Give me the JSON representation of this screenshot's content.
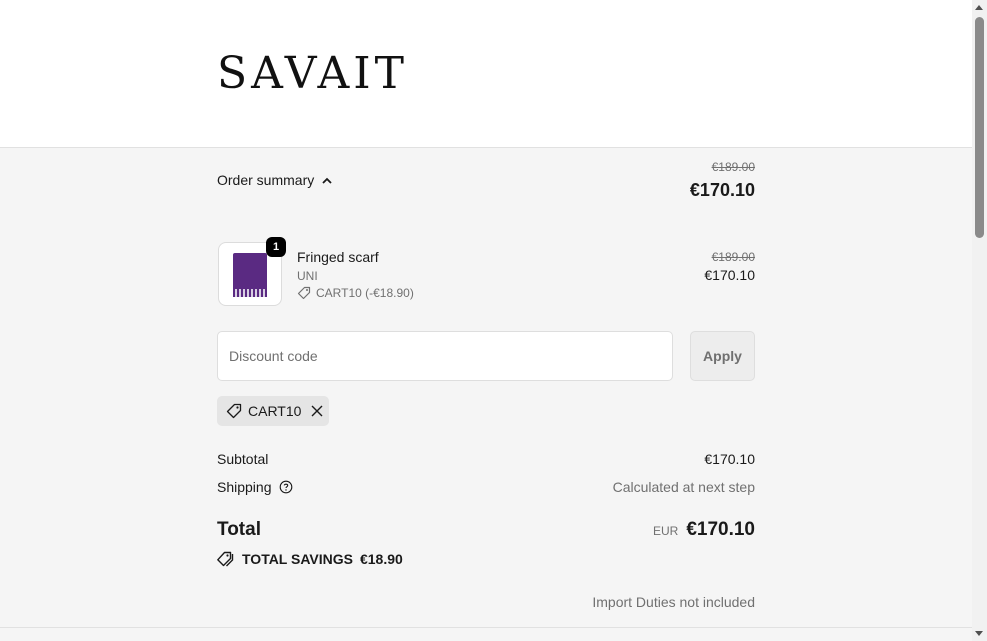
{
  "brand": {
    "logo_text": "SAVAIT"
  },
  "order_summary": {
    "toggle_label": "Order summary",
    "original_price": "€189.00",
    "total_price": "€170.10",
    "chevron_icon": "chevron-up-icon"
  },
  "line_item": {
    "quantity": "1",
    "name": "Fringed scarf",
    "variant": "UNI",
    "discount_label": "CART10 (-€18.90)",
    "original_price": "€189.00",
    "price": "€170.10",
    "thumbnail_color": "#5a2a82"
  },
  "discount": {
    "placeholder": "Discount code",
    "value": "",
    "apply_label": "Apply",
    "applied_code": "CART10"
  },
  "totals": {
    "subtotal_label": "Subtotal",
    "subtotal_value": "€170.10",
    "shipping_label": "Shipping",
    "shipping_value": "Calculated at next step",
    "total_label": "Total",
    "currency": "EUR",
    "total_value": "€170.10",
    "savings_label": "TOTAL SAVINGS",
    "savings_value": "€18.90",
    "duties_note": "Import Duties not included"
  },
  "colors": {
    "background_panel": "#f5f5f5",
    "text_primary": "#1a1a1a",
    "text_muted": "#707070"
  }
}
